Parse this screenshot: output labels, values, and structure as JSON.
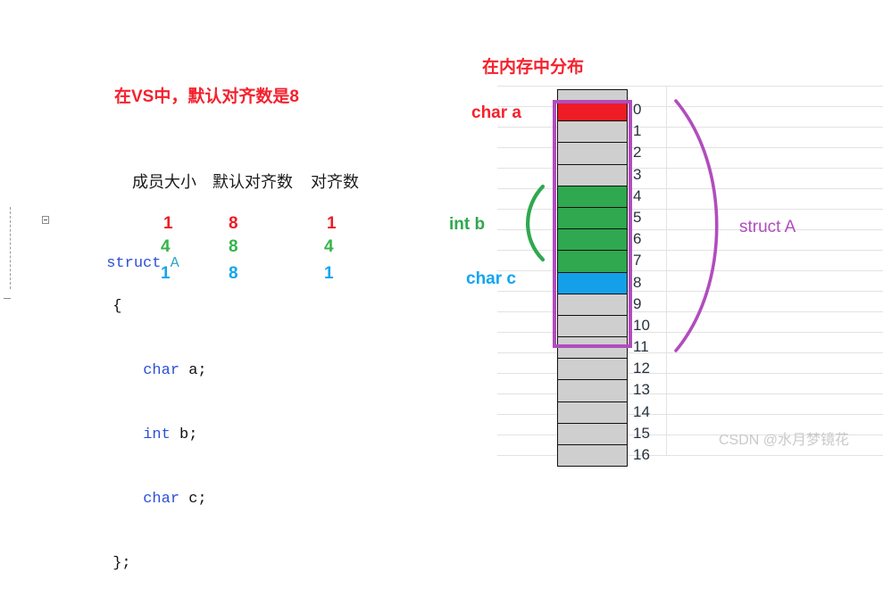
{
  "titles": {
    "vs_note": "在VS中，默认对齐数是8",
    "memory_layout": "在内存中分布"
  },
  "code": {
    "lines": [
      {
        "kw": "struct",
        "name": " A"
      },
      {
        "text": "{"
      },
      {
        "kw": "char",
        "rest": " a;"
      },
      {
        "kw": "int",
        "rest": " b;"
      },
      {
        "kw": "char",
        "rest": " c;"
      },
      {
        "text": "};"
      }
    ],
    "struct_keyword": "struct",
    "struct_name": "A",
    "brace_open": "{",
    "brace_close": "};",
    "member1_type": "char",
    "member1_rest": " a;",
    "member2_type": "int",
    "member2_rest": " b;",
    "member3_type": "char",
    "member3_rest": " c;"
  },
  "table": {
    "headers": {
      "size": "成员大小",
      "default_align": "默认对齐数",
      "align": "对齐数"
    },
    "rows": [
      {
        "member": "char a;",
        "size": "1",
        "default_align": "8",
        "align": "1",
        "color": "#ee1c25"
      },
      {
        "member": "int b;",
        "size": "4",
        "default_align": "8",
        "align": "4",
        "color": "#35b44a"
      },
      {
        "member": "char c;",
        "size": "1",
        "default_align": "8",
        "align": "1",
        "color": "#12a5ef"
      }
    ]
  },
  "memory": {
    "cells": [
      {
        "index": "0",
        "fill": "red",
        "inside_struct": true
      },
      {
        "index": "1",
        "fill": "gray",
        "inside_struct": true
      },
      {
        "index": "2",
        "fill": "gray",
        "inside_struct": true
      },
      {
        "index": "3",
        "fill": "gray",
        "inside_struct": true
      },
      {
        "index": "4",
        "fill": "green",
        "inside_struct": true
      },
      {
        "index": "5",
        "fill": "green",
        "inside_struct": true
      },
      {
        "index": "6",
        "fill": "green",
        "inside_struct": true
      },
      {
        "index": "7",
        "fill": "green",
        "inside_struct": true
      },
      {
        "index": "8",
        "fill": "blue",
        "inside_struct": true
      },
      {
        "index": "9",
        "fill": "gray",
        "inside_struct": true
      },
      {
        "index": "10",
        "fill": "gray",
        "inside_struct": true
      },
      {
        "index": "11",
        "fill": "gray",
        "inside_struct": true
      },
      {
        "index": "12",
        "fill": "gray",
        "inside_struct": false
      },
      {
        "index": "13",
        "fill": "gray",
        "inside_struct": false
      },
      {
        "index": "14",
        "fill": "gray",
        "inside_struct": false
      },
      {
        "index": "15",
        "fill": "gray",
        "inside_struct": false
      },
      {
        "index": "16",
        "fill": "gray",
        "inside_struct": false
      }
    ]
  },
  "annotations": {
    "char_a": "char a",
    "int_b": "int b",
    "char_c": "char c",
    "struct_a": "struct A"
  },
  "colors": {
    "red": "#ee1c25",
    "green": "#2fa84f",
    "blue": "#14a0e8",
    "purple": "#b24cbe",
    "gray_cell": "#cfcfcf",
    "grid": "#e2e2e2",
    "code_keyword": "#2b50d8",
    "code_type": "#3aa9c7"
  },
  "watermark": "CSDN @水月梦镜花"
}
